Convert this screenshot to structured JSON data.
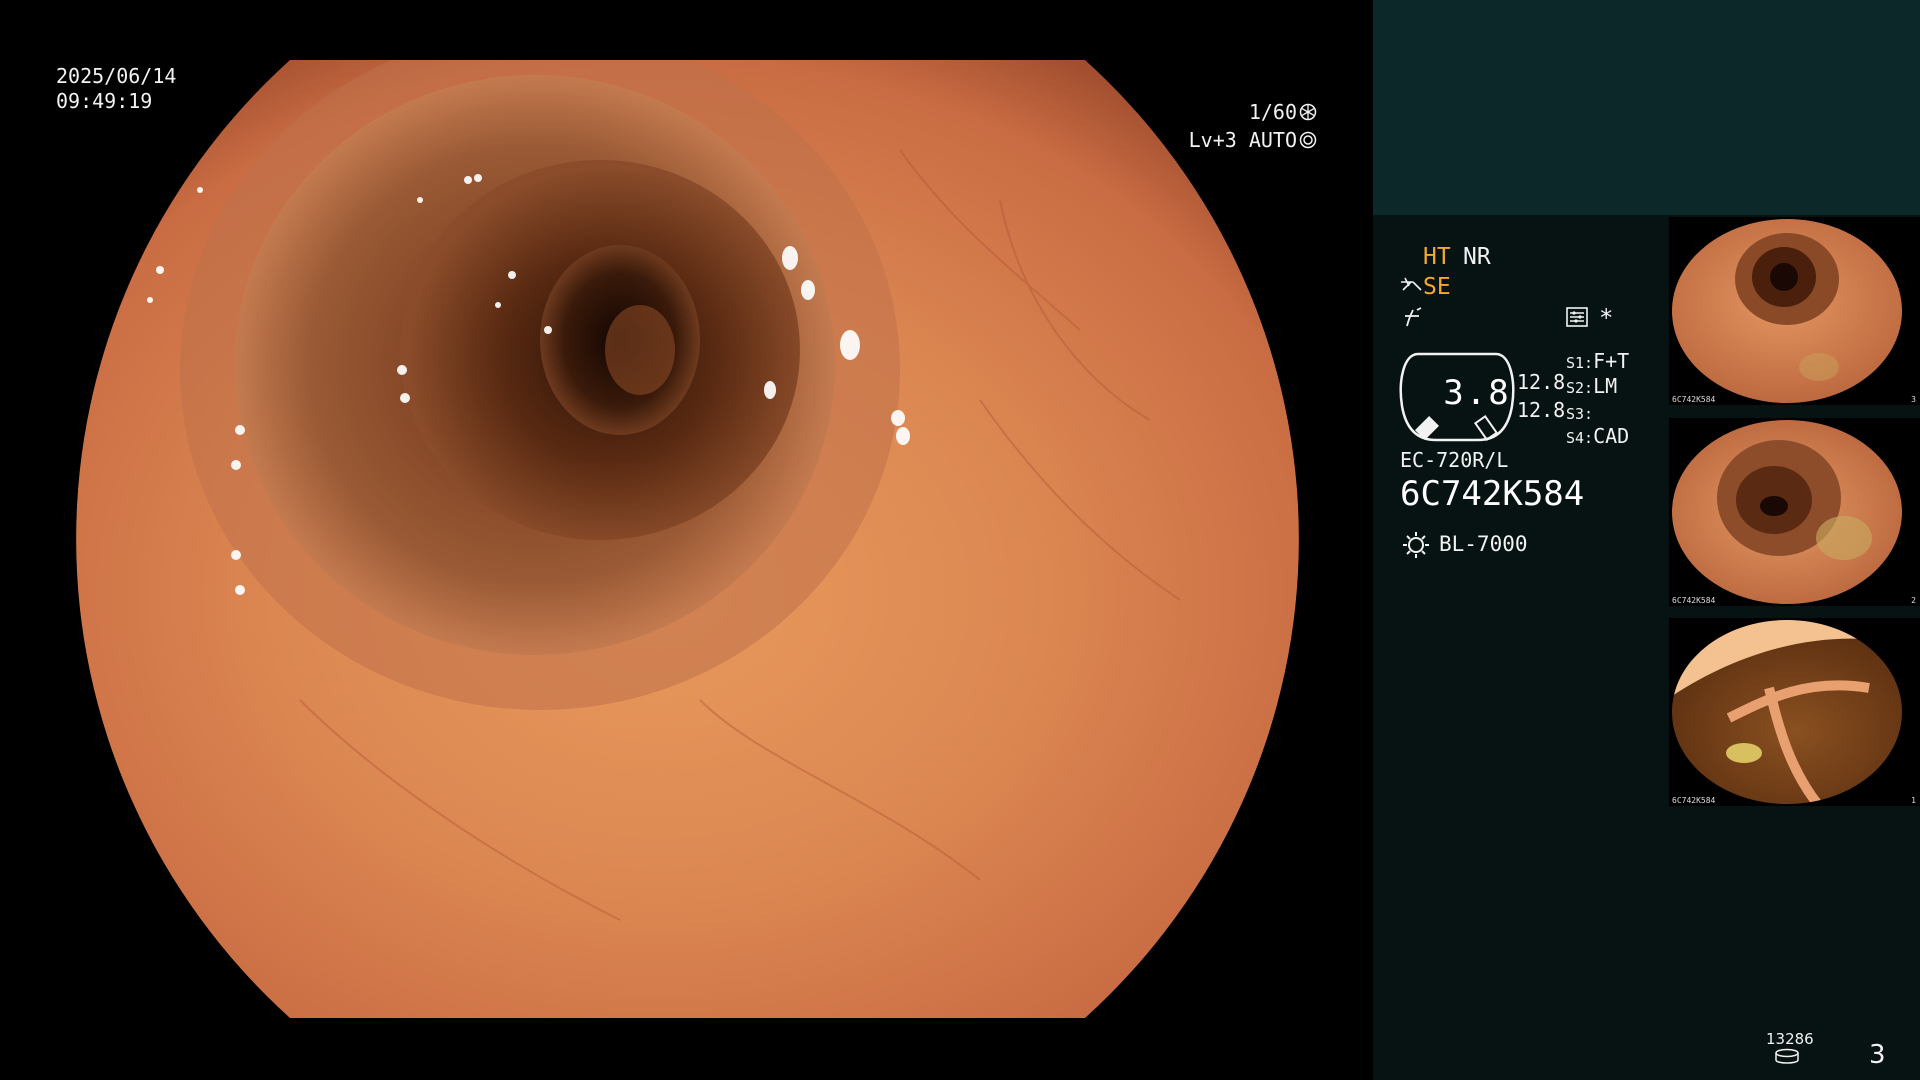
{
  "osd": {
    "date": "2025/06/14",
    "time": "09:49:19",
    "shutter": "1/60",
    "level": "Lv+3 AUTO"
  },
  "panel": {
    "mode_ht": "HT",
    "mode_nr": "NR",
    "mode_se": "SE",
    "zoom": "3.8",
    "val_1": "12.8",
    "val_2": "12.8",
    "slots": [
      {
        "key": "S1:",
        "value": "F+T"
      },
      {
        "key": "S2:",
        "value": "LM"
      },
      {
        "key": "S3:",
        "value": ""
      },
      {
        "key": "S4:",
        "value": "CAD"
      }
    ],
    "scope_model": "EC-720R/L",
    "scope_serial": "6C742K584",
    "light_source": "BL-7000",
    "count": "13286",
    "page_number": "3",
    "star": "*"
  },
  "thumbnails": [
    {
      "serial": "6C742K584",
      "num": "3"
    },
    {
      "serial": "6C742K584",
      "num": "2"
    },
    {
      "serial": "6C742K584",
      "num": "1"
    }
  ],
  "colors": {
    "panel_bg": "#071213",
    "panel_top": "#0d2828",
    "mode_active": "#f5a82b",
    "tissue": "#d9804e",
    "lumen": "#3a1a0a"
  },
  "icons": {
    "shutter": "aperture-icon",
    "auto": "iris-icon",
    "se": "scope-tip-icon",
    "f": "freeze-icon",
    "menu": "menu-icon",
    "light": "light-source-icon",
    "count": "storage-icon"
  }
}
